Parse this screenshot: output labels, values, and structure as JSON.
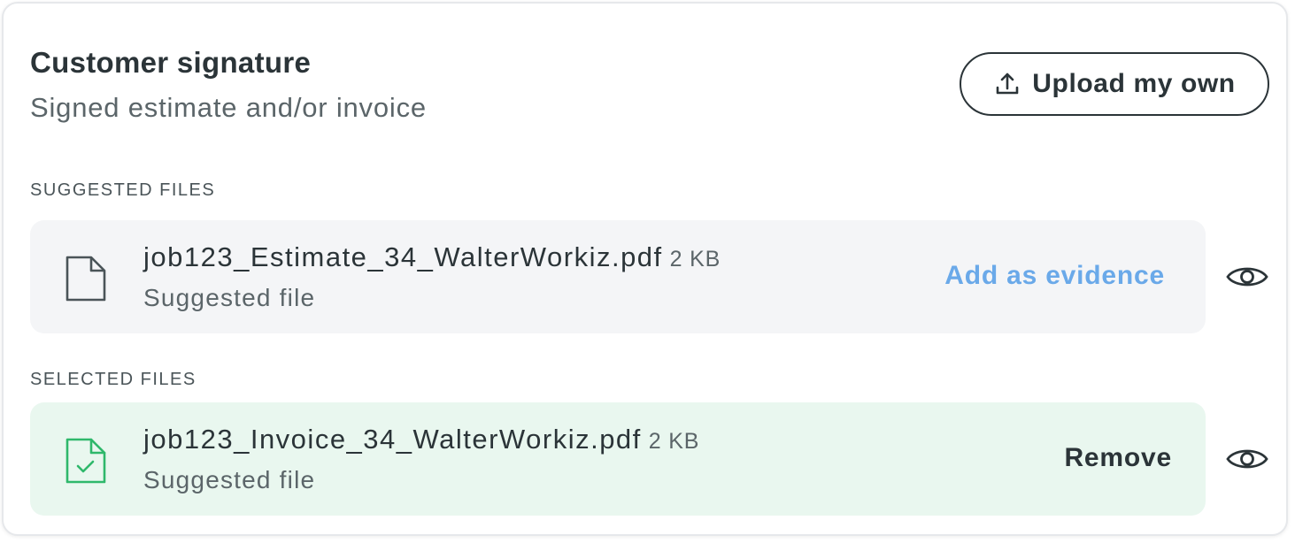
{
  "header": {
    "title": "Customer signature",
    "subtitle": "Signed estimate and/or invoice"
  },
  "upload_button": {
    "label": "Upload my own",
    "icon": "upload-icon"
  },
  "suggested": {
    "section_label": "SUGGESTED FILES",
    "file": {
      "name": "job123_Estimate_34_WalterWorkiz.pdf",
      "size": "2 KB",
      "subtitle": "Suggested file",
      "icon": "document-icon",
      "action_label": "Add as evidence",
      "view_icon": "eye-icon"
    }
  },
  "selected": {
    "section_label": "SELECTED FILES",
    "file": {
      "name": "job123_Invoice_34_WalterWorkiz.pdf",
      "size": "2 KB",
      "subtitle": "Suggested file",
      "icon": "document-check-icon",
      "action_label": "Remove",
      "view_icon": "eye-icon"
    }
  },
  "colors": {
    "text_primary": "#2b3438",
    "text_secondary": "#5b6569",
    "link_blue": "#6aa9e9",
    "suggested_bg": "#f4f5f7",
    "selected_bg": "#e9f7ef",
    "success_green": "#2fb86b"
  }
}
